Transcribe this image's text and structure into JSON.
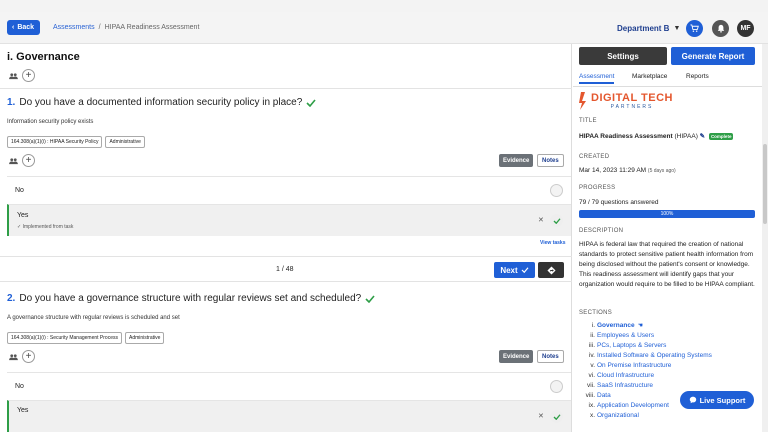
{
  "header": {
    "back_label": "Back",
    "breadcrumb_root": "Assessments",
    "breadcrumb_sep": "/",
    "breadcrumb_current": "HIPAA Readiness Assessment",
    "department": "Department B",
    "avatar_initials": "MF"
  },
  "main": {
    "title": "i. Governance",
    "questions": [
      {
        "number": "1.",
        "text": "Do you have a documented information security policy in place?",
        "subtitle": "Information security policy exists",
        "tags": [
          "164.308(a)(1)(i) : HIPAA Security Policy",
          "Administrative"
        ],
        "evidence_label": "Evidence",
        "notes_label": "Notes",
        "options": [
          {
            "label": "No",
            "selected": false
          },
          {
            "label": "Yes",
            "selected": true,
            "sub": "✓ Implemented from task"
          }
        ],
        "view_tasks": "View tasks"
      },
      {
        "number": "2.",
        "text": "Do you have a governance structure with regular reviews set and scheduled?",
        "subtitle": "A governance structure with regular reviews is scheduled and set",
        "tags": [
          "164.308(a)(1)(i) : Security Management Process",
          "Administrative"
        ],
        "evidence_label": "Evidence",
        "notes_label": "Notes",
        "options": [
          {
            "label": "No",
            "selected": false
          },
          {
            "label": "Yes",
            "selected": true
          }
        ]
      }
    ],
    "pager": {
      "text": "1 / 48",
      "next_label": "Next"
    }
  },
  "sidebar": {
    "settings_label": "Settings",
    "report_label": "Generate Report",
    "tabs": [
      "Assessment",
      "Marketplace",
      "Reports"
    ],
    "logo_line1": "DIGITAL TECH",
    "logo_line2": "PARTNERS",
    "title_heading": "TITLE",
    "title_value": "HIPAA Readiness Assessment",
    "title_abbr": "(HIPAA)",
    "status_badge": "Complete",
    "created_heading": "CREATED",
    "created_value": "Mar 14, 2023 11:29 AM",
    "created_ago": "(5 days ago)",
    "progress_heading": "PROGRESS",
    "progress_text": "79 / 79 questions answered",
    "progress_percent": 100,
    "progress_label": "100%",
    "description_heading": "DESCRIPTION",
    "description": "HIPAA is federal law that required the creation of national standards to protect sensitive patient health information from being disclosed without the patient's consent or knowledge. This readiness assessment will identify gaps that your organization would require to be filled to be HIPAA compliant.",
    "sections_heading": "SECTIONS",
    "sections": [
      {
        "n": "i.",
        "label": "Governance"
      },
      {
        "n": "ii.",
        "label": "Employees & Users"
      },
      {
        "n": "iii.",
        "label": "PCs, Laptops & Servers"
      },
      {
        "n": "iv.",
        "label": "Installed Software & Operating Systems"
      },
      {
        "n": "v.",
        "label": "On Premise Infrastructure"
      },
      {
        "n": "vi.",
        "label": "Cloud Infrastructure"
      },
      {
        "n": "vii.",
        "label": "SaaS Infrastructure"
      },
      {
        "n": "viii.",
        "label": "Data"
      },
      {
        "n": "ix.",
        "label": "Application Development"
      },
      {
        "n": "x.",
        "label": "Organizational"
      }
    ]
  },
  "live_support": "Live Support",
  "colors": {
    "primary": "#1f5fd6",
    "success": "#2e9e47",
    "brand_orange": "#e4572e"
  }
}
